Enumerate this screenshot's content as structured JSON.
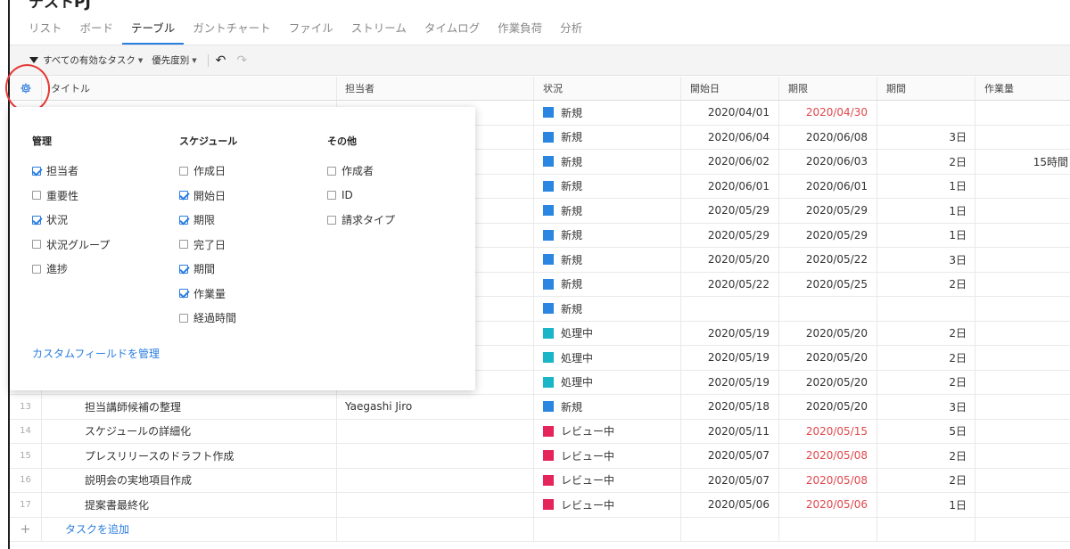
{
  "project": {
    "title": "テストPJ"
  },
  "tabs": [
    "リスト",
    "ボード",
    "テーブル",
    "ガントチャート",
    "ファイル",
    "ストリーム",
    "タイムログ",
    "作業負荷",
    "分析"
  ],
  "active_tab": "テーブル",
  "toolbar": {
    "filter_label": "すべての有効なタスク",
    "sort_label": "優先度別",
    "undo_icon": "undo-icon",
    "redo_icon": "redo-icon"
  },
  "columns": {
    "title": "タイトル",
    "assignee": "担当者",
    "status": "状況",
    "start": "開始日",
    "due": "期限",
    "duration": "期間",
    "effort": "作業量"
  },
  "status_colors": {
    "新規": "#2a86e0",
    "処理中": "#1ab6c8",
    "レビュー中": "#e4245a"
  },
  "rows": [
    {
      "num": "",
      "title": "",
      "assignee": "",
      "status": "新規",
      "start": "2020/04/01",
      "due": "2020/04/30",
      "due_overdue": true,
      "duration": "",
      "effort": ""
    },
    {
      "num": "",
      "title": "",
      "assignee": "",
      "status": "新規",
      "start": "2020/06/04",
      "due": "2020/06/08",
      "due_overdue": false,
      "duration": "3日",
      "effort": ""
    },
    {
      "num": "",
      "title": "",
      "assignee": "",
      "status": "新規",
      "start": "2020/06/02",
      "due": "2020/06/03",
      "due_overdue": false,
      "duration": "2日",
      "effort": "15時間"
    },
    {
      "num": "",
      "title": "",
      "assignee": "",
      "status": "新規",
      "start": "2020/06/01",
      "due": "2020/06/01",
      "due_overdue": false,
      "duration": "1日",
      "effort": ""
    },
    {
      "num": "",
      "title": "",
      "assignee": "",
      "status": "新規",
      "start": "2020/05/29",
      "due": "2020/05/29",
      "due_overdue": false,
      "duration": "1日",
      "effort": ""
    },
    {
      "num": "",
      "title": "",
      "assignee": "",
      "status": "新規",
      "start": "2020/05/29",
      "due": "2020/05/29",
      "due_overdue": false,
      "duration": "1日",
      "effort": ""
    },
    {
      "num": "",
      "title": "",
      "assignee": "",
      "status": "新規",
      "start": "2020/05/20",
      "due": "2020/05/22",
      "due_overdue": false,
      "duration": "3日",
      "effort": ""
    },
    {
      "num": "",
      "title": "",
      "assignee": "",
      "status": "新規",
      "start": "2020/05/22",
      "due": "2020/05/25",
      "due_overdue": false,
      "duration": "2日",
      "effort": ""
    },
    {
      "num": "",
      "title": "",
      "assignee": "",
      "status": "新規",
      "start": "",
      "due": "",
      "due_overdue": false,
      "duration": "",
      "effort": ""
    },
    {
      "num": "",
      "title": "",
      "assignee": "",
      "status": "処理中",
      "start": "2020/05/19",
      "due": "2020/05/20",
      "due_overdue": false,
      "duration": "2日",
      "effort": ""
    },
    {
      "num": "",
      "title": "",
      "assignee": "",
      "status": "処理中",
      "start": "2020/05/19",
      "due": "2020/05/20",
      "due_overdue": false,
      "duration": "2日",
      "effort": ""
    },
    {
      "num": "",
      "title": "",
      "assignee": "",
      "status": "処理中",
      "start": "2020/05/19",
      "due": "2020/05/20",
      "due_overdue": false,
      "duration": "2日",
      "effort": ""
    },
    {
      "num": "13",
      "title": "担当講師候補の整理",
      "assignee": "Yaegashi Jiro",
      "status": "新規",
      "start": "2020/05/18",
      "due": "2020/05/20",
      "due_overdue": false,
      "duration": "3日",
      "effort": ""
    },
    {
      "num": "14",
      "title": "スケジュールの詳細化",
      "assignee": "",
      "status": "レビュー中",
      "start": "2020/05/11",
      "due": "2020/05/15",
      "due_overdue": true,
      "duration": "5日",
      "effort": ""
    },
    {
      "num": "15",
      "title": "プレスリリースのドラフト作成",
      "assignee": "",
      "status": "レビュー中",
      "start": "2020/05/07",
      "due": "2020/05/08",
      "due_overdue": true,
      "duration": "2日",
      "effort": ""
    },
    {
      "num": "16",
      "title": "説明会の実地項目作成",
      "assignee": "",
      "status": "レビュー中",
      "start": "2020/05/07",
      "due": "2020/05/08",
      "due_overdue": true,
      "duration": "2日",
      "effort": ""
    },
    {
      "num": "17",
      "title": "提案書最終化",
      "assignee": "",
      "status": "レビュー中",
      "start": "2020/05/06",
      "due": "2020/05/06",
      "due_overdue": true,
      "duration": "1日",
      "effort": ""
    }
  ],
  "add_task": {
    "plus": "+",
    "label": "タスクを追加"
  },
  "column_settings": {
    "groups": [
      {
        "heading": "管理",
        "options": [
          {
            "label": "担当者",
            "checked": true
          },
          {
            "label": "重要性",
            "checked": false
          },
          {
            "label": "状況",
            "checked": true
          },
          {
            "label": "状況グループ",
            "checked": false
          },
          {
            "label": "進捗",
            "checked": false
          }
        ]
      },
      {
        "heading": "スケジュール",
        "options": [
          {
            "label": "作成日",
            "checked": false
          },
          {
            "label": "開始日",
            "checked": true
          },
          {
            "label": "期限",
            "checked": true
          },
          {
            "label": "完了日",
            "checked": false
          },
          {
            "label": "期間",
            "checked": true
          },
          {
            "label": "作業量",
            "checked": true
          },
          {
            "label": "経過時間",
            "checked": false
          }
        ]
      },
      {
        "heading": "その他",
        "options": [
          {
            "label": "作成者",
            "checked": false
          },
          {
            "label": "ID",
            "checked": false
          },
          {
            "label": "請求タイプ",
            "checked": false
          }
        ]
      }
    ],
    "manage_link": "カスタムフィールドを管理"
  }
}
